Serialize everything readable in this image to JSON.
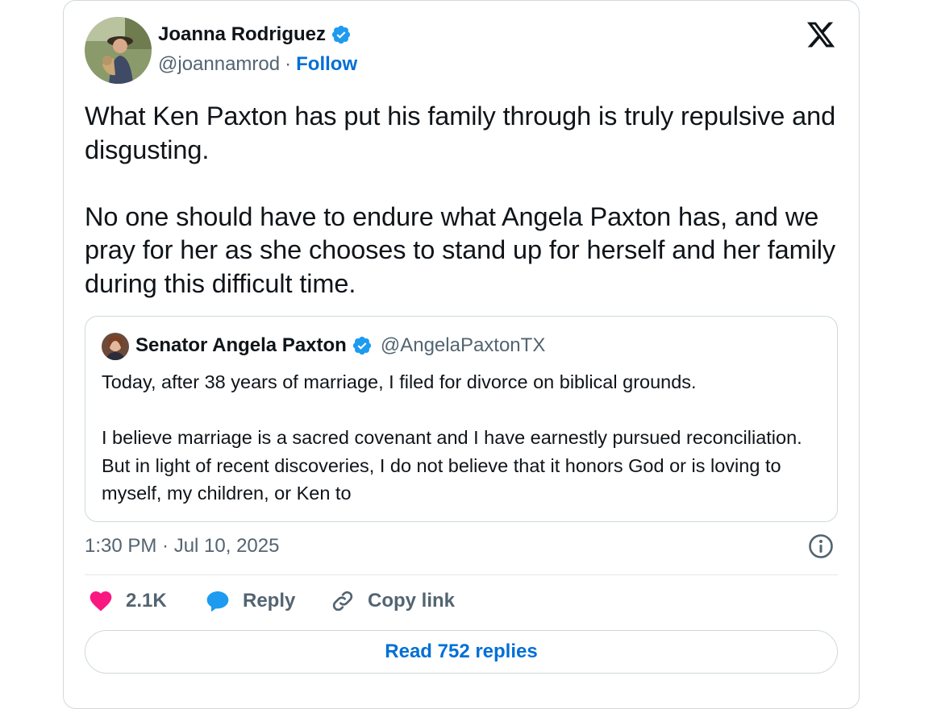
{
  "author": {
    "name": "Joanna Rodriguez",
    "handle": "@joannamrod",
    "separator": "·",
    "follow_label": "Follow"
  },
  "tweet": {
    "text": "What Ken Paxton has put his family through is truly repulsive and disgusting.\n\nNo one should have to endure what Angela Paxton has, and we pray for her as she chooses to stand up for herself and her family during this difficult time."
  },
  "quote": {
    "name": "Senator Angela Paxton",
    "handle": "@AngelaPaxtonTX",
    "text": "Today, after 38 years of marriage, I filed for divorce on biblical grounds.\n\nI believe marriage is a sacred covenant and I have earnestly pursued reconciliation. But in light of recent discoveries, I do not believe that it honors God or is loving to myself, my children, or Ken to"
  },
  "timestamp": "1:30 PM · Jul 10, 2025",
  "actions": {
    "like_count": "2.1K",
    "reply_label": "Reply",
    "copy_label": "Copy link"
  },
  "read_replies_label": "Read 752 replies",
  "colors": {
    "link": "#006fd6",
    "verified": "#1d9bf0",
    "like": "#f91880",
    "muted": "#536471",
    "border": "#cfd9de"
  },
  "icons": [
    "x-logo-icon",
    "verified-badge-icon",
    "info-icon",
    "heart-icon",
    "reply-bubble-icon",
    "link-icon"
  ]
}
